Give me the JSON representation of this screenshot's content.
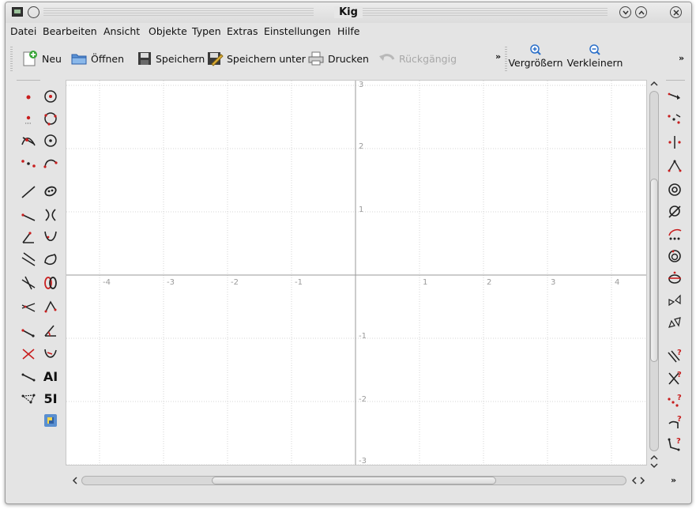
{
  "window": {
    "title": "Kig"
  },
  "menu": [
    "Datei",
    "Bearbeiten",
    "Ansicht",
    "Objekte",
    "Typen",
    "Extras",
    "Einstellungen",
    "Hilfe"
  ],
  "toolbar": {
    "new": "Neu",
    "open": "Öffnen",
    "save": "Speichern",
    "save_as": "Speichern unter",
    "print": "Drucken",
    "undo": "Rückgängig",
    "zoom_in": "Vergrößern",
    "zoom_out": "Verkleinern",
    "overflow": "»"
  },
  "left_tools": {
    "text_label": "AI",
    "script_label": "5I"
  },
  "right_tools": {
    "overflow": "»"
  },
  "axes": {
    "x_ticks": [
      "-4",
      "-3",
      "-2",
      "-1",
      "1",
      "2",
      "3",
      "4"
    ],
    "y_ticks": [
      "3",
      "2",
      "1",
      "-1",
      "-2",
      "-3"
    ]
  },
  "scrollbars": {
    "h_left": "<",
    "h_right": "< >",
    "v_up": "^",
    "v_down": "⌃⌄"
  },
  "colors": {
    "accent_blue": "#2a6fc9",
    "tool_red": "#c81e1e",
    "window_bg": "#e4e4e4",
    "grid": "#d6d6d6",
    "axis": "#9a9a9a"
  }
}
